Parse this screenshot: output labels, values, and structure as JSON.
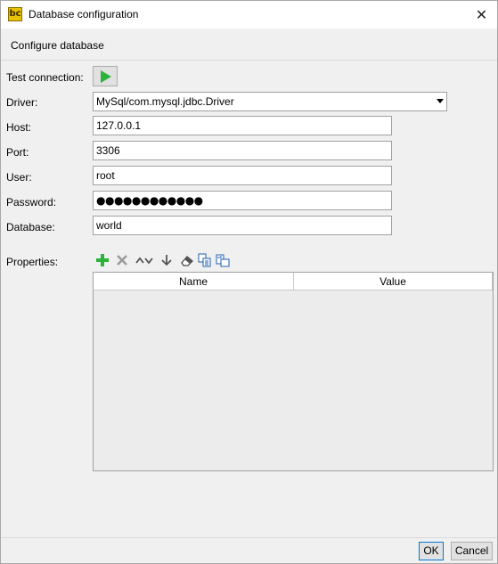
{
  "window": {
    "title": "Database configuration",
    "close_glyph": "✕",
    "app_icon": "bc-app-icon"
  },
  "header": {
    "text": "Configure database"
  },
  "form": {
    "test_connection_label": "Test connection:",
    "driver_label": "Driver:",
    "driver_value": "MySql/com.mysql.jdbc.Driver",
    "host_label": "Host:",
    "host_value": "127.0.0.1",
    "port_label": "Port:",
    "port_value": "3306",
    "user_label": "User:",
    "user_value": "root",
    "password_label": "Password:",
    "password_value": "●●●●●●●●●●●●",
    "database_label": "Database:",
    "database_value": "world"
  },
  "properties": {
    "label": "Properties:",
    "toolbar_icons": [
      "add-icon",
      "remove-icon",
      "move-up-icon",
      "move-down-icon",
      "download-icon",
      "eraser-icon",
      "copy-icon",
      "paste-icon"
    ],
    "columns": [
      "Name",
      "Value"
    ],
    "rows": []
  },
  "buttons": {
    "ok": "OK",
    "cancel": "Cancel"
  },
  "colors": {
    "play_green": "#2db23a",
    "add_green": "#2db23a",
    "focus_blue": "#0078d7"
  }
}
